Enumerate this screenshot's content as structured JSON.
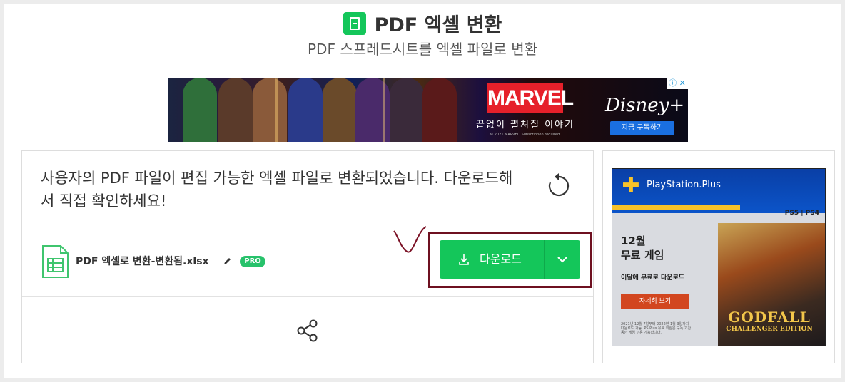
{
  "header": {
    "title": "PDF 엑셀 변환",
    "subtitle": "PDF 스프레드시트를 엑셀 파일로 변환"
  },
  "ad_banner": {
    "brand": "MARVEL",
    "tagline": "끝없이 펼쳐질 이야기",
    "copyright": "© 2021 MARVEL. Subscription required.",
    "service": "Disney+",
    "cta": "지금 구독하기",
    "adchoice_label": "ⓘ ✕"
  },
  "result": {
    "message": "사용자의 PDF 파일이 편집 가능한 엑셀 파일로 변환되었습니다. 다운로드해서 직접 확인하세요!",
    "file_name": "PDF 엑셀로 변환-변환됨.xlsx",
    "pro_badge": "PRO",
    "download_label": "다운로드"
  },
  "side_ad": {
    "brand": "PlayStation.Plus",
    "consoles": "PS5 | PS4",
    "month": "12월",
    "headline": "무료 게임",
    "description": "이달에 무료로 다운로드",
    "cta": "자세히 보기",
    "fine_print": "2021년 12월 7일부터 2022년 1월 3일까지 다운로드 가능. PS Plus 유료 회원은 구독 기간 동안 게임 이용 가능합니다.",
    "game_title": "GODFALL",
    "game_edition": "CHALLENGER EDITION"
  },
  "colors": {
    "accent": "#14c65a",
    "highlight_box": "#6e1020",
    "pro_badge": "#27c26b"
  },
  "icons": {
    "tool": "spreadsheet-icon",
    "refresh": "refresh-icon",
    "file": "xlsx-file-icon",
    "edit": "pencil-icon",
    "download": "download-icon",
    "dropdown": "chevron-down-icon",
    "share": "share-icon"
  }
}
